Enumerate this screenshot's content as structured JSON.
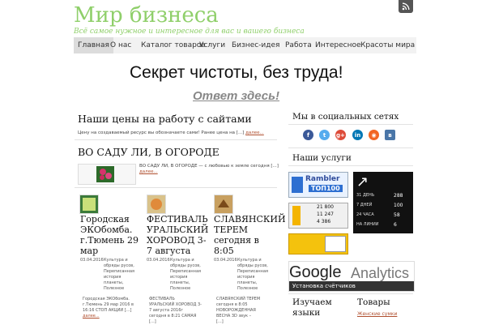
{
  "header": {
    "site_title": "Мир бизнеса",
    "tagline": "Всё самое нужное и интересное для вас и вашего бизнеса"
  },
  "nav": {
    "items": [
      {
        "label": "Главная"
      },
      {
        "label": "О нас"
      },
      {
        "label": "Каталог товаров"
      },
      {
        "label": "Услуги"
      },
      {
        "label": "Бизнес-идея"
      },
      {
        "label": "Работа"
      },
      {
        "label": "Интересное"
      },
      {
        "label": "Красоты мира"
      }
    ]
  },
  "banner": {
    "title": "Секрет чистоты, без труда!",
    "link_text": "Ответ здесь!"
  },
  "post1": {
    "title": "Наши цены на работу с сайтами",
    "excerpt": "Цену на создаваемый ресурс вы обозначаете сами! Ранее цена на [...]",
    "more": "далее..."
  },
  "post2": {
    "title": "ВО САДУ ЛИ, В ОГОРОДЕ",
    "excerpt": "ВО САДУ ЛИ, В ОГОРОДЕ — с любовью к земле сегодня [...]",
    "more": "далее..."
  },
  "posts": [
    {
      "title_lines": [
        "Городская",
        "ЭКОбомба.",
        "г.Тюмень 29",
        "мар"
      ],
      "date": "03.04.2016",
      "category_lines": [
        "Культура и",
        "обряды русов,",
        "Переписанная",
        "история",
        "планеты,",
        "Полезное"
      ],
      "excerpt_lines": [
        "Городская ЭКОбомба.",
        "г.Тюмень 29 мар 2016 в",
        "16:16 СТОП АКЦИИ [...]"
      ],
      "more": "далее..."
    },
    {
      "title_lines": [
        "ФЕСТИВАЛЬ",
        "УРАЛЬСКИЙ",
        "ХОРОВОД 3-",
        "7 августа"
      ],
      "date": "03.04.2016",
      "category_lines": [
        "Культура и",
        "обряды русов,",
        "Переписанная",
        "история",
        "планеты,",
        "Полезное"
      ],
      "excerpt_lines": [
        "ФЕСТИВАЛЬ",
        "УРАЛЬСКИЙ ХОРОВОД 3-",
        "7 августа 2016г",
        "сегодня в 8:21 САМАЯ",
        "[...]"
      ],
      "more": "далее..."
    },
    {
      "title_lines": [
        "СЛАВЯНСКИЙ",
        "ТЕРЕМ",
        "сегодня в",
        "8:05"
      ],
      "date": "03.04.2016",
      "category_lines": [
        "Культура и",
        "обряды русов,",
        "Переписанная",
        "история",
        "планеты,",
        "Полезное"
      ],
      "excerpt_lines": [
        "СЛАВЯНСКИЙ ТЕРЕМ",
        "сегодня в 8:05",
        "НОВОРОЖДЕННАЯ",
        "ВЕСНА 3D звук –",
        "[...]"
      ],
      "more": "далее..."
    }
  ],
  "sidebar": {
    "social_heading": "Мы в социальных сетях",
    "social_icons": [
      "facebook-icon",
      "twitter-icon",
      "google-plus-icon",
      "linkedin-icon",
      "rss-icon",
      "vkontakte-icon"
    ],
    "services_heading": "Наши услуги",
    "ramblar": {
      "line1": "Rambler",
      "line2": "ТОП100"
    },
    "counter1": {
      "v1": "21 800",
      "v2": "11 247",
      "v3": "4 386"
    },
    "counter2": {
      "labels": [
        "31 ДЕНЬ",
        "7 ДНЕЙ",
        "24 ЧАСА",
        "НА ЛИНИИ"
      ],
      "values": [
        "288",
        "100",
        "58",
        "6"
      ]
    },
    "ga": {
      "google": "Google",
      "analytics": "Analytics",
      "caption": "Установка счётчиков"
    },
    "interesting_heading": "Изучаем языки",
    "goods_heading": "Товары",
    "goods_item": "Женские сумки"
  },
  "colors": {
    "title_green": "#8fcf6a",
    "link_red": "#b05030",
    "nav_bg": "#f2f2f2"
  }
}
